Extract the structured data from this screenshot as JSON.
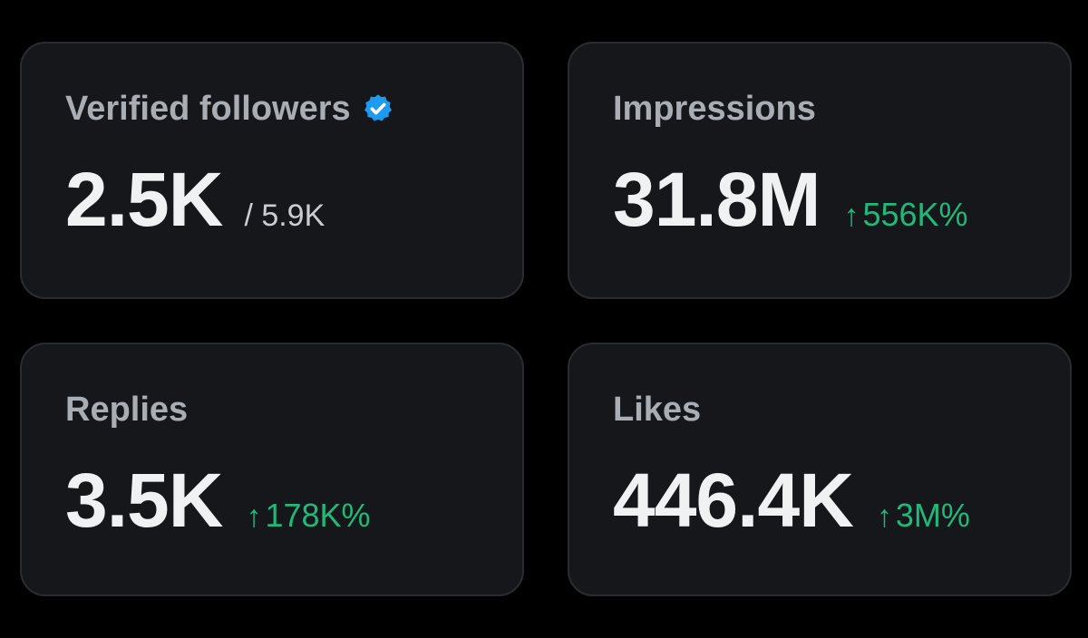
{
  "accent_colors": {
    "positive": "#21b87c",
    "verified_badge": "#1d9bf0",
    "card_background": "#16171b",
    "page_background": "#000000"
  },
  "cards": {
    "verified_followers": {
      "label": "Verified followers",
      "icon": "verified-badge-icon",
      "value": "2.5K",
      "total": "/ 5.9K"
    },
    "impressions": {
      "label": "Impressions",
      "value": "31.8M",
      "arrow": "↑",
      "delta": "556K%"
    },
    "replies": {
      "label": "Replies",
      "value": "3.5K",
      "arrow": "↑",
      "delta": "178K%"
    },
    "likes": {
      "label": "Likes",
      "value": "446.4K",
      "arrow": "↑",
      "delta": "3M%"
    }
  }
}
